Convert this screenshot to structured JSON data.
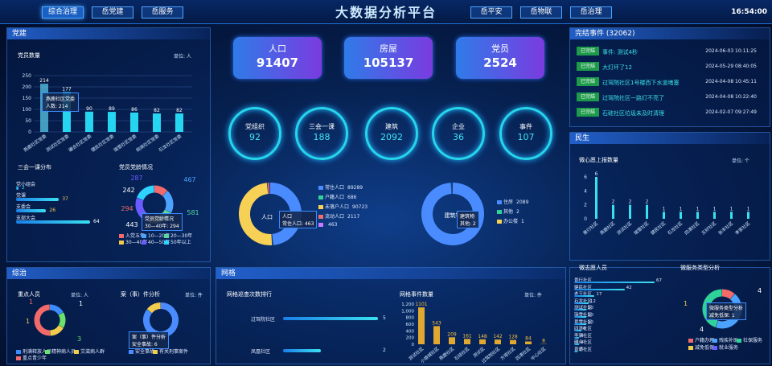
{
  "header": {
    "title": "大数据分析平台",
    "time": "16:54:00",
    "left_tabs": [
      "综合治理",
      "岳党建",
      "岳服务"
    ],
    "right_tabs": [
      "岳平安",
      "岳物联",
      "岳治理"
    ]
  },
  "dangjian": {
    "title": "党建",
    "sub1": "党员数量",
    "unit": "单位: 人",
    "bar_labels": [
      "214",
      "177",
      "90",
      "89",
      "86",
      "82",
      "82"
    ],
    "bar_cats": [
      "燕鹿社区党委",
      "测试社区党委",
      "碾合社区党委",
      "健民社区党委",
      "瑞雪社区党委",
      "皖南社区党委",
      "石龙社区党委"
    ],
    "y_ticks": [
      "250",
      "200",
      "150",
      "100",
      "50",
      "0"
    ],
    "tooltip1": "燕鹿社区党委",
    "tooltip2": "人数: 214",
    "sub2": "三会一课分布",
    "sub3": "党员党龄情况",
    "meeting_items": [
      {
        "label": "党小组会",
        "value": "2"
      },
      {
        "label": "党课",
        "value": "37"
      },
      {
        "label": "支委会",
        "value": "26"
      },
      {
        "label": "支部大会",
        "value": "64"
      }
    ],
    "age_vals": [
      "287",
      "467",
      "242",
      "294",
      "581",
      "443"
    ],
    "age_tooltip1": "党员党龄情况",
    "age_tooltip2": "30—40年: 294",
    "age_legend": [
      "入党五年",
      "10—20年",
      "20—30年",
      "30—40年",
      "40—50年",
      "50年以上"
    ]
  },
  "stats": [
    {
      "label": "人口",
      "value": "91407"
    },
    {
      "label": "房屋",
      "value": "105137"
    },
    {
      "label": "党员",
      "value": "2524"
    }
  ],
  "rings": [
    {
      "label": "党组织",
      "value": "92"
    },
    {
      "label": "三会一课",
      "value": "188"
    },
    {
      "label": "建筑",
      "value": "2092"
    },
    {
      "label": "企业",
      "value": "36"
    },
    {
      "label": "事件",
      "value": "107"
    }
  ],
  "pop_donut": {
    "center": "人口",
    "tip1": "人口",
    "tip2": "常住人口: 463",
    "legend": [
      {
        "label": "常住人口",
        "value": "89289"
      },
      {
        "label": "户籍人口",
        "value": "686"
      },
      {
        "label": "未落户人口",
        "value": "90723"
      },
      {
        "label": "流动人口",
        "value": "2117"
      },
      {
        "label": "",
        "value": "463"
      }
    ]
  },
  "house_donut": {
    "center": "建筑物",
    "tip1": "建筑物",
    "tip2": "其他: 2",
    "legend": [
      {
        "label": "住房",
        "value": "2089"
      },
      {
        "label": "其他",
        "value": "2"
      },
      {
        "label": "办公楼",
        "value": "1"
      }
    ]
  },
  "events": {
    "title": "完结事件 (32062)",
    "items": [
      {
        "tag": "已完结",
        "text": "事件: 测试4秒",
        "date": "2024-06-03 10:11:25"
      },
      {
        "tag": "已完结",
        "text": "大灯坏了12",
        "date": "2024-05-29 08:40:05"
      },
      {
        "tag": "已完结",
        "text": "过驾院社区1号楼西下水道堵塞",
        "date": "2024-04-08 10:45:11"
      },
      {
        "tag": "已完结",
        "text": "过驾院社区一路灯不亮了",
        "date": "2024-04-08 10:22:40"
      },
      {
        "tag": "已完结",
        "text": "石硅社区垃圾未及时清理",
        "date": "2024-02-07 09:27:49"
      }
    ]
  },
  "minsheng": {
    "title": "民生",
    "sub": "微心愿上报数量",
    "unit": "单位: 个",
    "y_ticks": [
      "6",
      "4",
      "2",
      "0"
    ],
    "bar_labels": [
      "6",
      "2",
      "2",
      "2",
      "1",
      "1",
      "1",
      "1",
      "1",
      "1"
    ],
    "cats": [
      "景行社区",
      "燕鹿社区",
      "测试社区",
      "瑞雪社区",
      "健民社区",
      "石龙社区",
      "四清社区",
      "五好社区",
      "张丰社区",
      "李家社区"
    ]
  },
  "zongzhi": {
    "title": "综治",
    "sub1": "重点人员",
    "unit1": "单位: 人",
    "sub2": "案（事）件分析",
    "unit2": "单位: 件",
    "donut1_vals": [
      "1",
      "1",
      "1",
      "3"
    ],
    "legend1": [
      "刑满释放人员",
      "精神病人员",
      "艾滋病人群",
      "重点青少年"
    ],
    "donut2_tip1": "案（事）件分析",
    "donut2_tip2": "安全事故: 6",
    "legend2": [
      "安全事故",
      "有关刑事案件"
    ]
  },
  "wangge": {
    "title": "网格",
    "sub1": "网格巡查次数排行",
    "sub2": "网格事件数量",
    "unit": "单位: 件",
    "rank": [
      {
        "label": "过驾院社区",
        "value": "5"
      },
      {
        "label": "凤凰社区",
        "value": "2"
      }
    ],
    "y_ticks": [
      "1,200",
      "1,000",
      "800",
      "600",
      "400",
      "200",
      "0"
    ],
    "bar_vals": [
      "1101",
      "543",
      "209",
      "161",
      "148",
      "142",
      "128",
      "84",
      "8"
    ],
    "cats": [
      "测试社区",
      "小墩城社区",
      "燕鹿社区",
      "石硅社区",
      "测试区",
      "过驾院社区",
      "方塔社区",
      "四清社区",
      "中心社区"
    ]
  },
  "right_bottom": {
    "sub1": "微志愿人员",
    "sub2": "微服务类型分析",
    "vol_items": [
      "景行社区",
      "健民社区",
      "老王社区",
      "石龙社区",
      "测试社区",
      "瑞雪社区",
      "景雪社区",
      "四清社区",
      "李家社区",
      "碾合社区",
      "普通社区"
    ],
    "vol_vals": [
      "67",
      "42",
      "17",
      "12",
      "10",
      "10",
      "10",
      "6",
      "4",
      "4",
      "1"
    ],
    "svc_vals": [
      "1",
      "4",
      "4"
    ],
    "svc_tip1": "微服务类型分析",
    "svc_tip2": "减免低保: 1",
    "svc_legend": [
      "户籍办理",
      "残疾补助",
      "社保服务",
      "减免低保",
      "就业服务"
    ]
  }
}
